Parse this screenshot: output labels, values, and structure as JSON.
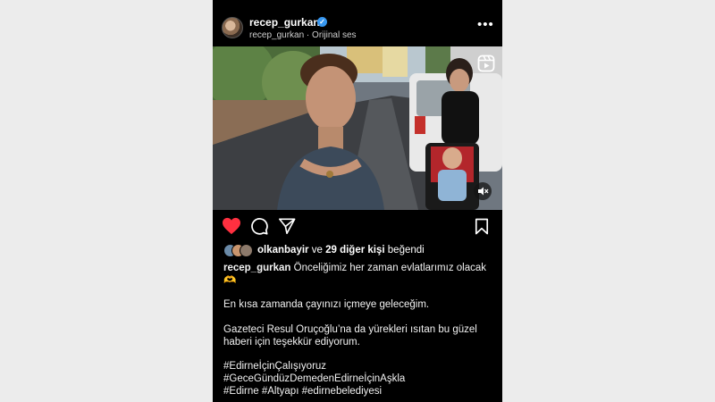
{
  "post": {
    "username": "recep_gurkan",
    "verified_mark": "✓",
    "subtitle_user": "recep_gurkan",
    "subtitle_sep": " · ",
    "audio": "Orijinal ses",
    "more": "•••"
  },
  "likes": {
    "first_user": "olkanbayir",
    "connector": "ve",
    "others": "29 diğer kişi",
    "suffix": "beğendi"
  },
  "caption": {
    "author": "recep_gurkan",
    "line1": "Önceliğimiz her zaman evlatlarımız olacak",
    "emoji": "🫶",
    "para2": "En kısa zamanda çayınızı içmeye geleceğim.",
    "para3_line1": "Gazeteci Resul Oruçoğlu’na da yürekleri ısıtan bu güzel",
    "para3_line2": "haberi için teşekkür ediyorum.",
    "tag1": "#EdirneİçinÇalışıyoruz",
    "tag2": "#GeceGündüzDemedenEdirneİçinAşkla",
    "tag3": "#Edirne #Altyapı #edirnebelediyesi"
  },
  "colors": {
    "like_red": "#ff3040",
    "verified_blue": "#3797f0",
    "background": "#000000"
  },
  "icons": [
    "heart-icon",
    "comment-icon",
    "share-icon",
    "bookmark-icon",
    "reels-icon",
    "muted-icon",
    "more-icon"
  ]
}
